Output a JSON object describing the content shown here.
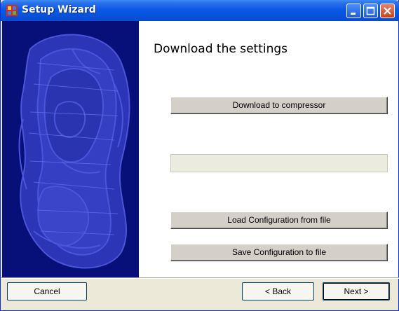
{
  "window": {
    "title": "Setup Wizard",
    "app_icon": "setup-wizard-icon",
    "controls": [
      "minimize-icon",
      "maximize-icon",
      "close-icon"
    ]
  },
  "side_panel": {
    "image": "decorative-artwork",
    "background": "#070f78"
  },
  "page": {
    "heading": "Download the settings",
    "download_button": "Download to compressor",
    "progress": {
      "value": 0
    },
    "load_button": "Load Configuration from file",
    "save_button": "Save Configuration to file"
  },
  "footer": {
    "cancel_label": "Cancel",
    "back_label": "< Back",
    "next_label": "Next >"
  }
}
